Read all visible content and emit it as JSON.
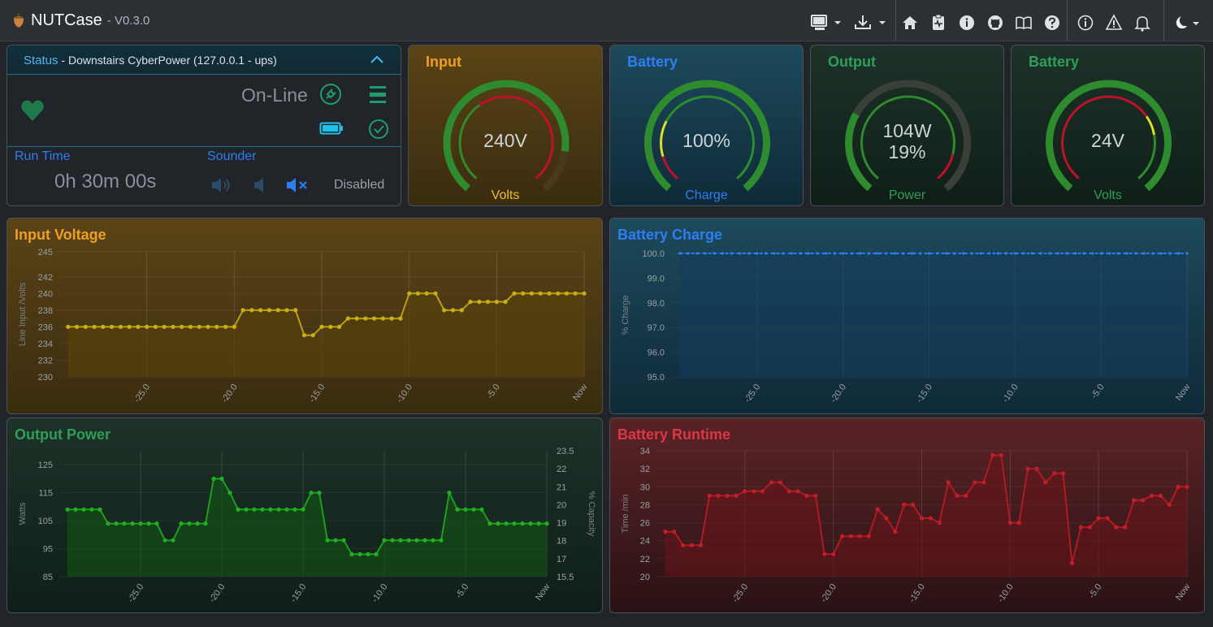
{
  "app": {
    "name": "NUTCase",
    "version": "- V0.3.0"
  },
  "navbar": {
    "icons": [
      "monitor-icon",
      "download-icon",
      "home-icon",
      "clipboard-icon",
      "info-icon",
      "github-icon",
      "book-icon",
      "help-icon",
      "about-icon",
      "warning-icon",
      "bell-icon",
      "theme-icon"
    ]
  },
  "status": {
    "title": "Status",
    "device": " - Downstairs CyberPower (127.0.0.1 - ups)",
    "state": "On-Line",
    "runtime_label": "Run Time",
    "runtime_value": "0h 30m 00s",
    "sounder_label": "Sounder",
    "sounder_state": "Disabled"
  },
  "gauges": {
    "input": {
      "title": "Input",
      "value": "240V",
      "sub": "Volts",
      "color": "#f0a020"
    },
    "battery_charge": {
      "title": "Battery",
      "value": "100%",
      "sub": "Charge",
      "color": "#2d7ef0"
    },
    "output": {
      "title": "Output",
      "value1": "104W",
      "value2": "19%",
      "sub": "Power",
      "color": "#2e9e5a"
    },
    "battery_voltage": {
      "title": "Battery",
      "value": "24V",
      "sub": "Volts",
      "color": "#2e9e5a"
    }
  },
  "chart_data": [
    {
      "id": "input_voltage",
      "type": "line",
      "title": "Input Voltage",
      "ylabel": "Line Input /Volts",
      "ylim": [
        230,
        245
      ],
      "yticks": [
        "230",
        "232",
        "234",
        "236",
        "238",
        "240",
        "242",
        "245"
      ],
      "xticks": [
        "-25.0",
        "-20.0",
        "-15.0",
        "-10.0",
        "-5.0",
        "Now"
      ],
      "xlim": [
        -30,
        0
      ],
      "x": [
        -29.5,
        -29,
        -28.5,
        -28,
        -27.5,
        -27,
        -26.5,
        -26,
        -25.5,
        -25,
        -24.5,
        -24,
        -23.5,
        -23,
        -22.5,
        -22,
        -21.5,
        -21,
        -20.5,
        -20,
        -19.5,
        -19,
        -18.5,
        -18,
        -17.5,
        -17,
        -16.5,
        -16,
        -15.5,
        -15,
        -14.5,
        -14,
        -13.5,
        -13,
        -12.5,
        -12,
        -11.5,
        -11,
        -10.5,
        -10,
        -9.5,
        -9,
        -8.5,
        -8,
        -7.5,
        -7,
        -6.5,
        -6,
        -5.5,
        -5,
        -4.5,
        -4,
        -3.5,
        -3,
        -2.5,
        -2,
        -1.5,
        -1,
        -0.5,
        0
      ],
      "values": [
        236,
        236,
        236,
        236,
        236,
        236,
        236,
        236,
        236,
        236,
        236,
        236,
        236,
        236,
        236,
        236,
        236,
        236,
        236,
        236,
        238,
        238,
        238,
        238,
        238,
        238,
        238,
        235,
        235,
        236,
        236,
        236,
        237,
        237,
        237,
        237,
        237,
        237,
        237,
        240,
        240,
        240,
        240,
        238,
        238,
        238,
        239,
        239,
        239,
        239,
        239,
        240,
        240,
        240,
        240,
        240,
        240,
        240,
        240,
        240
      ]
    },
    {
      "id": "battery_charge",
      "type": "line",
      "title": "Battery Charge",
      "ylabel": "% Charge",
      "ylim": [
        95,
        100
      ],
      "yticks": [
        "95.0",
        "96.0",
        "97.0",
        "98.0",
        "99.0",
        "100.0"
      ],
      "xticks": [
        "-25.0",
        "-20.0",
        "-15.0",
        "-10.0",
        "-5.0",
        "Now"
      ],
      "xlim": [
        -30,
        0
      ],
      "x": [
        -29.5,
        -29,
        -28.5,
        -28,
        -27.5,
        -27,
        -26.5,
        -26,
        -25.5,
        -25,
        -24.5,
        -24,
        -23.5,
        -23,
        -22.5,
        -22,
        -21.5,
        -21,
        -20.5,
        -20,
        -19.5,
        -19,
        -18.5,
        -18,
        -17.5,
        -17,
        -16.5,
        -16,
        -15.5,
        -15,
        -14.5,
        -14,
        -13.5,
        -13,
        -12.5,
        -12,
        -11.5,
        -11,
        -10.5,
        -10,
        -9.5,
        -9,
        -8.5,
        -8,
        -7.5,
        -7,
        -6.5,
        -6,
        -5.5,
        -5,
        -4.5,
        -4,
        -3.5,
        -3,
        -2.5,
        -2,
        -1.5,
        -1,
        -0.5,
        0
      ],
      "values": [
        100,
        100,
        100,
        100,
        100,
        100,
        100,
        100,
        100,
        100,
        100,
        100,
        100,
        100,
        100,
        100,
        100,
        100,
        100,
        100,
        100,
        100,
        100,
        100,
        100,
        100,
        100,
        100,
        100,
        100,
        100,
        100,
        100,
        100,
        100,
        100,
        100,
        100,
        100,
        100,
        100,
        100,
        100,
        100,
        100,
        100,
        100,
        100,
        100,
        100,
        100,
        100,
        100,
        100,
        100,
        100,
        100,
        100,
        100,
        100
      ]
    },
    {
      "id": "output_power",
      "type": "line",
      "title": "Output Power",
      "ylabel": "Watts",
      "y2label": "% Capacity",
      "ylim": [
        85,
        130
      ],
      "yticks": [
        "85",
        "95",
        "105",
        "115",
        "125"
      ],
      "y2ticks": [
        "15.5",
        "17",
        "18",
        "19",
        "20",
        "21",
        "22",
        "23.5"
      ],
      "xticks": [
        "-25.0",
        "-20.0",
        "-15.0",
        "-10.0",
        "-5.0",
        "Now"
      ],
      "xlim": [
        -30,
        0
      ],
      "x": [
        -29.5,
        -29,
        -28.5,
        -28,
        -27.5,
        -27,
        -26.5,
        -26,
        -25.5,
        -25,
        -24.5,
        -24,
        -23.5,
        -23,
        -22.5,
        -22,
        -21.5,
        -21,
        -20.5,
        -20,
        -19.5,
        -19,
        -18.5,
        -18,
        -17.5,
        -17,
        -16.5,
        -16,
        -15.5,
        -15,
        -14.5,
        -14,
        -13.5,
        -13,
        -12.5,
        -12,
        -11.5,
        -11,
        -10.5,
        -10,
        -9.5,
        -9,
        -8.5,
        -8,
        -7.5,
        -7,
        -6.5,
        -6,
        -5.5,
        -5,
        -4.5,
        -4,
        -3.5,
        -3,
        -2.5,
        -2,
        -1.5,
        -1,
        -0.5,
        0
      ],
      "values": [
        109,
        109,
        109,
        109,
        109,
        104,
        104,
        104,
        104,
        104,
        104,
        104,
        98,
        98,
        104,
        104,
        104,
        104,
        120,
        120,
        115,
        109,
        109,
        109,
        109,
        109,
        109,
        109,
        109,
        109,
        115,
        115,
        98,
        98,
        98,
        93,
        93,
        93,
        93,
        98,
        98,
        98,
        98,
        98,
        98,
        98,
        98,
        115,
        109,
        109,
        109,
        109,
        104,
        104,
        104,
        104,
        104,
        104,
        104,
        104
      ]
    },
    {
      "id": "battery_runtime",
      "type": "line",
      "title": "Battery Runtime",
      "ylabel": "Time /min",
      "ylim": [
        20,
        34
      ],
      "yticks": [
        "20",
        "22",
        "24",
        "26",
        "28",
        "30",
        "32",
        "34"
      ],
      "xticks": [
        "-25.0",
        "-20.0",
        "-15.0",
        "-10.0",
        "-5.0",
        "Now"
      ],
      "xlim": [
        -30,
        0
      ],
      "x": [
        -29.5,
        -29,
        -28.5,
        -28,
        -27.5,
        -27,
        -26.5,
        -26,
        -25.5,
        -25,
        -24.5,
        -24,
        -23.5,
        -23,
        -22.5,
        -22,
        -21.5,
        -21,
        -20.5,
        -20,
        -19.5,
        -19,
        -18.5,
        -18,
        -17.5,
        -17,
        -16.5,
        -16,
        -15.5,
        -15,
        -14.5,
        -14,
        -13.5,
        -13,
        -12.5,
        -12,
        -11.5,
        -11,
        -10.5,
        -10,
        -9.5,
        -9,
        -8.5,
        -8,
        -7.5,
        -7,
        -6.5,
        -6,
        -5.5,
        -5,
        -4.5,
        -4,
        -3.5,
        -3,
        -2.5,
        -2,
        -1.5,
        -1,
        -0.5,
        0
      ],
      "values": [
        25,
        25,
        23.5,
        23.5,
        23.5,
        29,
        29,
        29,
        29,
        29.5,
        29.5,
        29.5,
        30.5,
        30.5,
        29.5,
        29.5,
        29,
        29,
        22.5,
        22.5,
        24.5,
        24.5,
        24.5,
        24.5,
        27.5,
        26.5,
        25,
        28,
        28,
        26.5,
        26.5,
        26,
        30.5,
        29,
        29,
        30.5,
        30.5,
        33.5,
        33.5,
        26,
        26,
        32,
        32,
        30.5,
        31.5,
        31.5,
        21.5,
        25.5,
        25.5,
        26.5,
        26.5,
        25.5,
        25.5,
        28.5,
        28.5,
        29,
        29,
        28,
        30,
        30
      ]
    }
  ]
}
